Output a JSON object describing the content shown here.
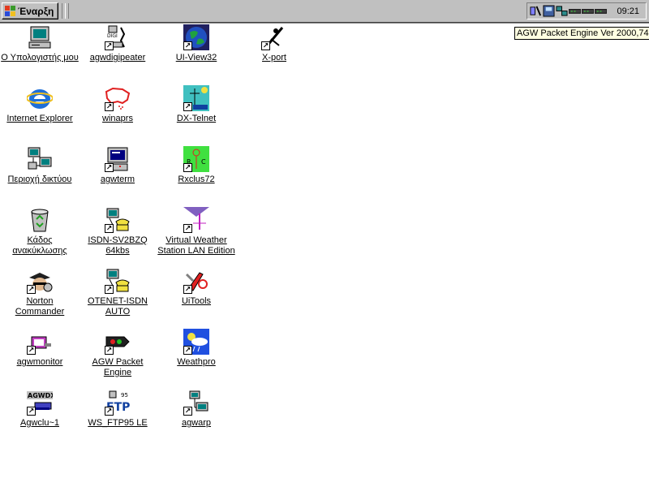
{
  "taskbar": {
    "start_label": "Έναρξη",
    "clock": "09:21",
    "tray_icons": [
      "agw-tray-icon",
      "disk-tray-icon",
      "network-tray-icon",
      "modem-tray-icon-1",
      "modem-tray-icon-2",
      "modem-tray-icon-3"
    ]
  },
  "tooltip": {
    "text": "AGW Packet Engine Ver 2000,74"
  },
  "desktop": {
    "icons": [
      {
        "label": "Ο Υπολογιστής μου",
        "icon": "computer-icon"
      },
      {
        "label": "Internet Explorer",
        "icon": "internet-explorer-icon"
      },
      {
        "label": "Περιοχή δικτύου",
        "icon": "network-icon"
      },
      {
        "label": "Κάδος ανακύκλωσης",
        "icon": "recycle-bin-icon"
      },
      {
        "label": "Norton Commander",
        "icon": "norton-commander-icon"
      },
      {
        "label": "agwmonitor",
        "icon": "agwmonitor-icon"
      },
      {
        "label": "Agwclu~1",
        "icon": "agwdx-icon"
      },
      {
        "label": "agwdigipeater",
        "icon": "digipeater-icon"
      },
      {
        "label": "winaprs",
        "icon": "winaprs-icon"
      },
      {
        "label": "agwterm",
        "icon": "agwterm-icon"
      },
      {
        "label": "ISDN-SV2BZQ 64kbs",
        "icon": "dialup-icon"
      },
      {
        "label": "OTENET-ISDN AUTO",
        "icon": "dialup-icon"
      },
      {
        "label": "AGW Packet Engine",
        "icon": "packet-engine-icon"
      },
      {
        "label": "WS_FTP95 LE",
        "icon": "ftp-icon"
      },
      {
        "label": "UI-View32",
        "icon": "globe-icon"
      },
      {
        "label": "DX-Telnet",
        "icon": "dx-telnet-icon"
      },
      {
        "label": "Rxclus72",
        "icon": "rxclus-icon"
      },
      {
        "label": "Virtual Weather Station LAN Edition",
        "icon": "weather-station-icon"
      },
      {
        "label": "UiTools",
        "icon": "uitools-icon"
      },
      {
        "label": "Weathpro",
        "icon": "weathpro-icon"
      },
      {
        "label": "agwarp",
        "icon": "agwarp-icon"
      },
      {
        "label": "X-port",
        "icon": "xport-icon"
      }
    ]
  }
}
